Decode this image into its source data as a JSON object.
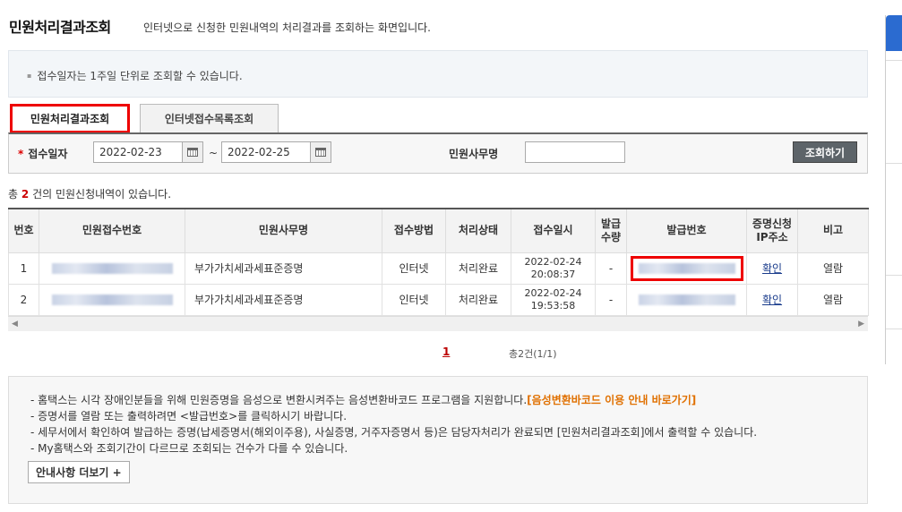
{
  "header": {
    "title": "민원처리결과조회",
    "description": "인터넷으로 신청한 민원내역의 처리결과를 조회하는 화면입니다."
  },
  "top_notice": "접수일자는 1주일 단위로 조회할 수 있습니다.",
  "tabs": [
    {
      "label": "민원처리결과조회",
      "active": true
    },
    {
      "label": "인터넷접수목록조회",
      "active": false
    }
  ],
  "search": {
    "date_label": "접수일자",
    "required_mark": "*",
    "start_date": "2022-02-23",
    "end_date": "2022-02-25",
    "tilde": "~",
    "office_label": "민원사무명",
    "office_value": "",
    "search_button": "조회하기"
  },
  "result_count": {
    "prefix": "총",
    "count": "2",
    "suffix": "건의 민원신청내역이 있습니다."
  },
  "table": {
    "headers": [
      "번호",
      "민원접수번호",
      "민원사무명",
      "접수방법",
      "처리상태",
      "접수일시",
      "발급\n수량",
      "발급번호",
      "증명신청\nIP주소",
      "비고"
    ],
    "rows": [
      {
        "no": "1",
        "office": "부가가치세과세표준증명",
        "method": "인터넷",
        "status": "처리완료",
        "date": "2022-02-24",
        "time": "20:08:37",
        "qty": "-",
        "ip": "확인",
        "note": "열람"
      },
      {
        "no": "2",
        "office": "부가가치세과세표준증명",
        "method": "인터넷",
        "status": "처리완료",
        "date": "2022-02-24",
        "time": "19:53:58",
        "qty": "-",
        "ip": "확인",
        "note": "열람"
      }
    ]
  },
  "pager": {
    "current": "1",
    "info": "총2건(1/1)"
  },
  "bottom_notice": {
    "line1_text": "- 홈택스는 시각 장애인분들을 위해 민원증명을 음성으로 변환시켜주는 음성변환바코드 프로그램을 지원합니다.",
    "line1_link": "[음성변환바코드 이용 안내 바로가기]",
    "line2": "- 증명서를 열람 또는 출력하려면 <발급번호>를 클릭하시기 바랍니다.",
    "line3": "- 세무서에서 확인하여 발급하는 증명(납세증명서(해외이주용), 사실증명, 거주자증명서 등)은 담당자처리가 완료되면 [민원처리결과조회]에서 출력할 수 있습니다.",
    "line4": "- My홈택스와 조회기간이 다르므로 조회되는 건수가 다를 수 있습니다.",
    "more_button": "안내사항 더보기 +"
  },
  "colors": {
    "accent_red": "#e00000",
    "link_orange": "#e07000",
    "button_gray": "#5d6469"
  }
}
